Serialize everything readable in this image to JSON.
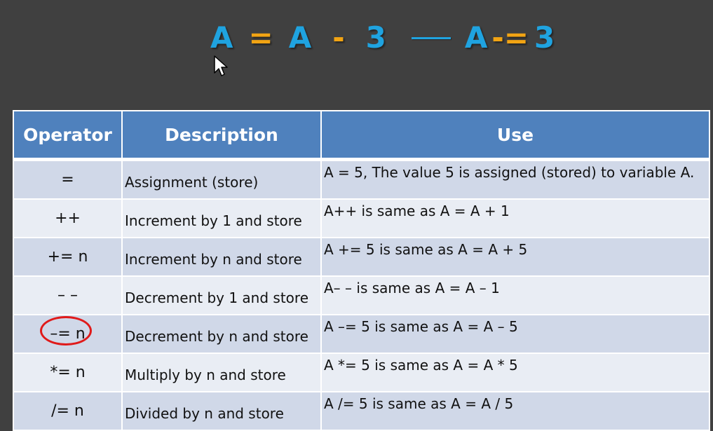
{
  "formula": {
    "a1": "A",
    "eq1": "=",
    "a2": "A",
    "minus": "-",
    "three1": "3",
    "a3": "A",
    "minus_eq": "-=",
    "three2": "3"
  },
  "table": {
    "headers": [
      "Operator",
      "Description",
      "Use"
    ],
    "rows": [
      {
        "operator": "=",
        "description": "Assignment (store)",
        "use": "A = 5, The value 5 is assigned (stored) to variable A."
      },
      {
        "operator": "++",
        "description": "Increment by 1 and store",
        "use": "A++ is same as A = A + 1"
      },
      {
        "operator": "+= n",
        "description": "Increment by n and store",
        "use": "A += 5 is same as A = A + 5"
      },
      {
        "operator": "– –",
        "description": "Decrement by 1 and store",
        "use": "A– – is same as A = A – 1"
      },
      {
        "operator": "–= n",
        "description": "Decrement by n and store",
        "use": "A –= 5 is same as A = A – 5",
        "circled": true
      },
      {
        "operator": "*= n",
        "description": "Multiply by n and store",
        "use": "A *= 5 is same as A = A * 5"
      },
      {
        "operator": "/= n",
        "description": "Divided by n and store",
        "use": "A /= 5 is same as A = A / 5"
      }
    ]
  },
  "colors": {
    "background": "#404040",
    "formula_blue": "#1fa3e0",
    "formula_orange": "#f2a413",
    "header_blue": "#4f81bd",
    "row_dark": "#d0d8e8",
    "row_light": "#e9edf4",
    "circle_red": "#e01a1a"
  },
  "icons": {
    "cursor": "mouse-pointer-icon",
    "highlight": "red-circle-annotation"
  }
}
